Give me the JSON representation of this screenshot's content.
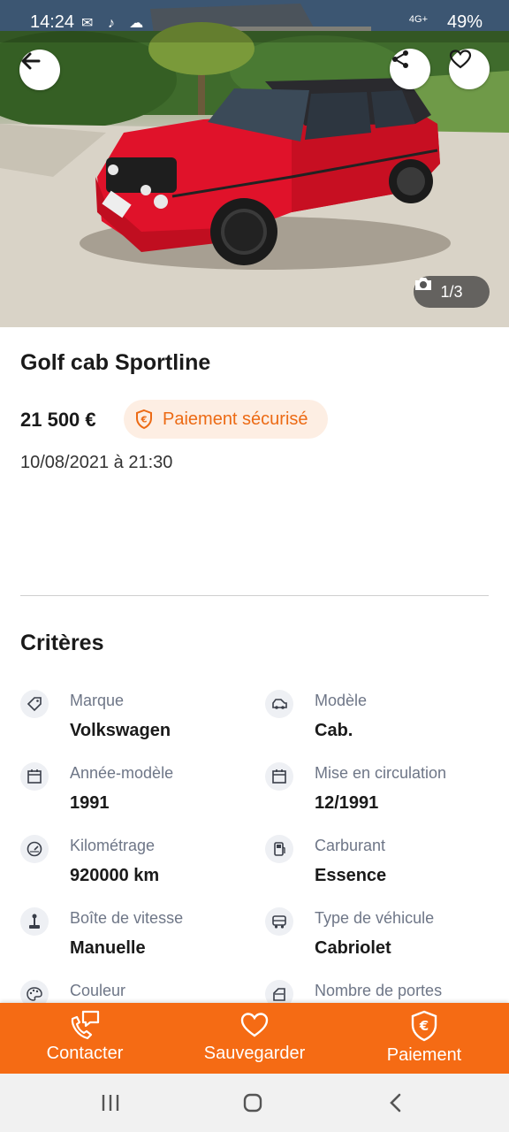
{
  "status_bar": {
    "time": "14:24",
    "network": "4G+",
    "battery": "49%"
  },
  "hero": {
    "photo_counter": "1/3"
  },
  "listing": {
    "title": "Golf cab Sportline",
    "price": "21 500 €",
    "secure_badge": "Paiement sécurisé",
    "date": "10/08/2021 à 21:30"
  },
  "criteria": {
    "heading": "Critères",
    "items": [
      {
        "label": "Marque",
        "value": "Volkswagen",
        "icon": "tag-icon"
      },
      {
        "label": "Modèle",
        "value": "Cab.",
        "icon": "car-model-icon"
      },
      {
        "label": "Année-modèle",
        "value": "1991",
        "icon": "calendar-icon"
      },
      {
        "label": "Mise en circulation",
        "value": "12/1991",
        "icon": "calendar-icon"
      },
      {
        "label": "Kilométrage",
        "value": "920000 km",
        "icon": "speedometer-icon"
      },
      {
        "label": "Carburant",
        "value": "Essence",
        "icon": "fuel-pump-icon"
      },
      {
        "label": "Boîte de vitesse",
        "value": "Manuelle",
        "icon": "gear-shift-icon"
      },
      {
        "label": "Type de véhicule",
        "value": "Cabriolet",
        "icon": "vehicle-type-icon"
      },
      {
        "label": "Couleur",
        "value": "",
        "icon": "palette-icon"
      },
      {
        "label": "Nombre de portes",
        "value": "",
        "icon": "car-door-icon"
      }
    ]
  },
  "action_bar": {
    "contact_label": "Contacter",
    "save_label": "Sauvegarder",
    "payment_label": "Paiement"
  },
  "colors": {
    "accent": "#f56b14",
    "badge_bg": "#fdeee3",
    "label_gray": "#6e7687"
  }
}
